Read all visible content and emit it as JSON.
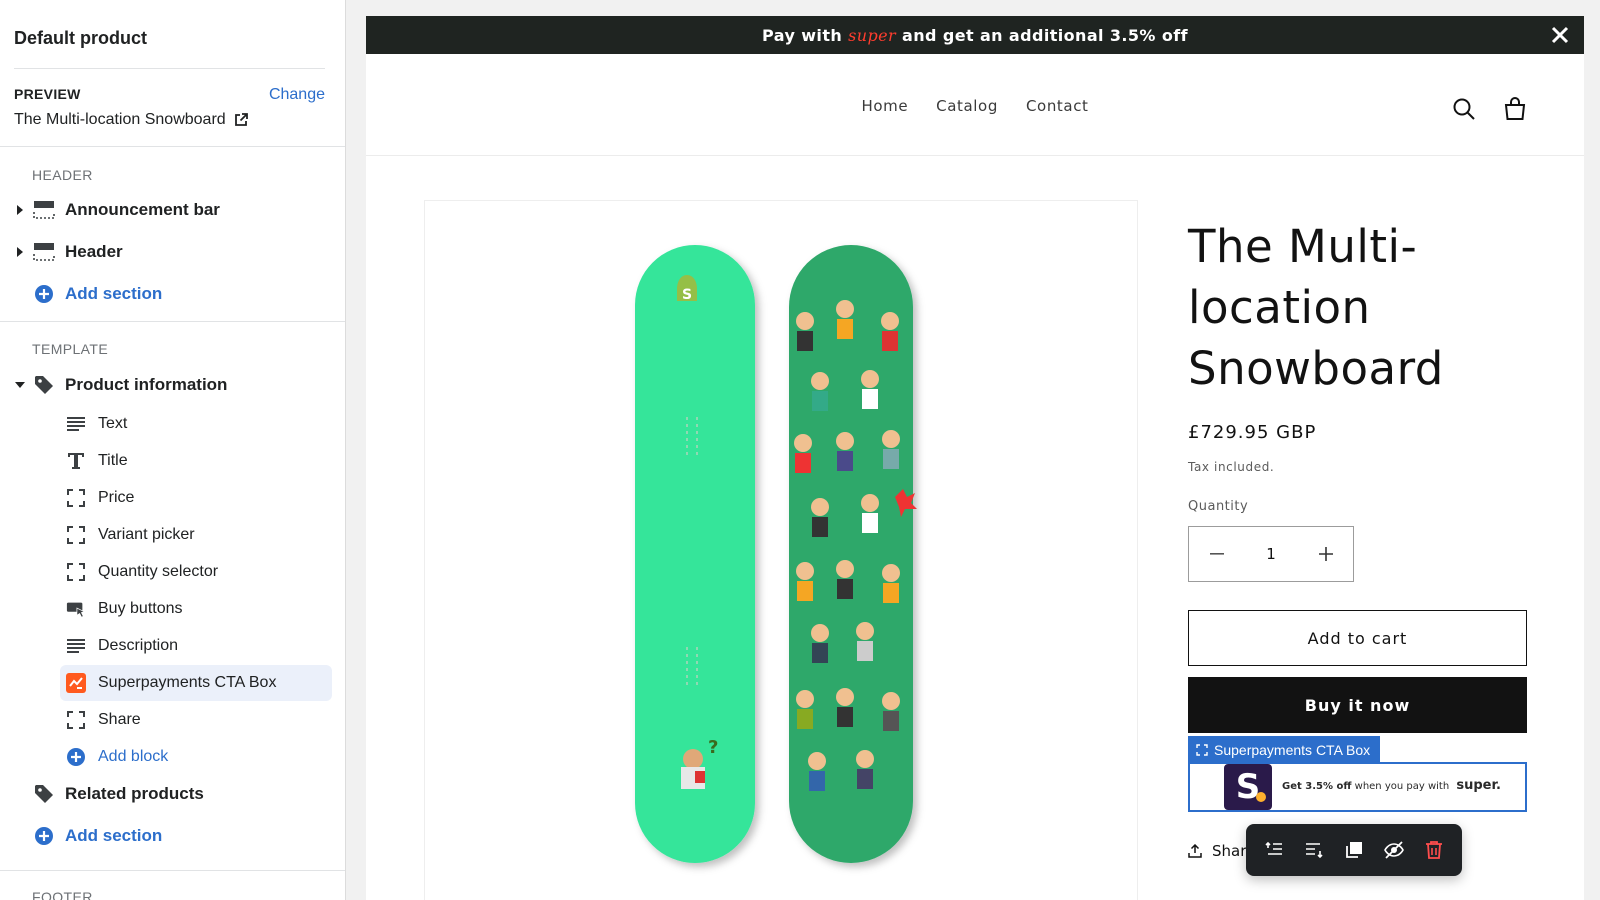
{
  "sidebar": {
    "title": "Default product",
    "preview": {
      "label": "PREVIEW",
      "change_label": "Change",
      "product": "The Multi-location Snowboard"
    },
    "header_group": {
      "label": "HEADER",
      "sections": [
        {
          "label": "Announcement bar",
          "icon": "layout-section-icon"
        },
        {
          "label": "Header",
          "icon": "layout-section-icon"
        }
      ],
      "add_label": "Add section"
    },
    "template_group": {
      "label": "TEMPLATE",
      "section_label": "Product information",
      "blocks": [
        {
          "label": "Text",
          "icon": "text-lines-icon"
        },
        {
          "label": "Title",
          "icon": "title-t-icon"
        },
        {
          "label": "Price",
          "icon": "block-bracket-icon"
        },
        {
          "label": "Variant picker",
          "icon": "block-bracket-icon"
        },
        {
          "label": "Quantity selector",
          "icon": "block-bracket-icon"
        },
        {
          "label": "Buy buttons",
          "icon": "buy-button-icon"
        },
        {
          "label": "Description",
          "icon": "text-lines-icon"
        },
        {
          "label": "Superpayments CTA Box",
          "icon": "superpayments-app-icon",
          "selected": true
        },
        {
          "label": "Share",
          "icon": "block-bracket-icon"
        }
      ],
      "add_block_label": "Add block",
      "related_label": "Related products",
      "add_section_label": "Add section"
    },
    "footer_label": "FOOTER"
  },
  "store": {
    "announcement": {
      "before": "Pay with",
      "brand": "super",
      "after": "and get an additional 3.5% off"
    },
    "nav": [
      "Home",
      "Catalog",
      "Contact"
    ],
    "product": {
      "title": "The Multi-location Snowboard",
      "price": "£729.95 GBP",
      "tax_note": "Tax included.",
      "quantity_label": "Quantity",
      "quantity": "1",
      "add_to_cart": "Add to cart",
      "buy_now": "Buy it now",
      "cta_tag": "Superpayments CTA Box",
      "cta_text_pre": "Get 3.5% off",
      "cta_text_mid": "when you pay with",
      "cta_brand": "super.",
      "share": "Shar"
    }
  },
  "colors": {
    "accent": "#2c6ecb",
    "announcement_bg": "#1f2421",
    "board_left": "#35e59a",
    "board_right": "#2fa86a",
    "super_red": "#ff3d2e"
  }
}
